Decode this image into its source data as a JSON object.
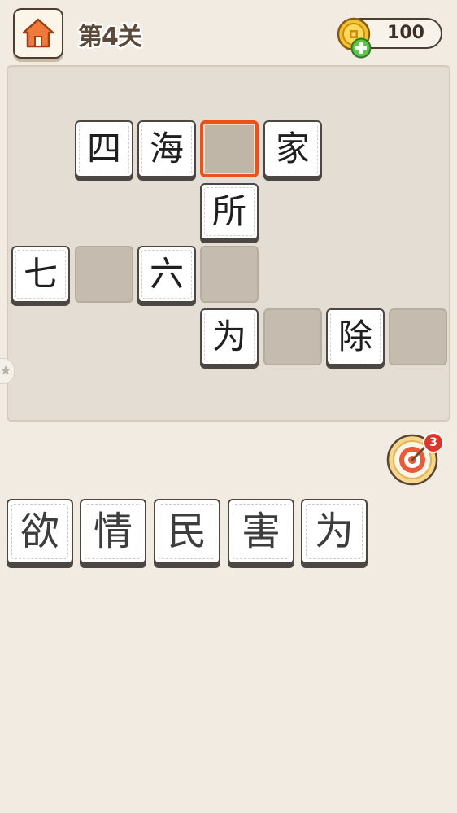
{
  "header": {
    "level_title": "第4关",
    "coins": "100"
  },
  "board": {
    "row1": [
      "四",
      "海",
      "",
      "家"
    ],
    "row2": [
      "所"
    ],
    "row3": [
      "七",
      "",
      "六",
      ""
    ],
    "row4": [
      "为",
      "",
      "除",
      ""
    ]
  },
  "hint": {
    "count": "3"
  },
  "choices": [
    "欲",
    "情",
    "民",
    "害",
    "为"
  ],
  "colors": {
    "background": "#f1ebe1",
    "board": "#e3ddd4",
    "empty_cell": "#c5bbae",
    "selected_border": "#e8531c",
    "home_icon": "#f07a3c",
    "coin": "#f2c32e",
    "badge": "#e0352a"
  },
  "icons": {
    "home": "home-icon",
    "coin": "coin-icon",
    "plus": "plus-icon",
    "hint": "target-icon",
    "side_tab": "star-icon"
  }
}
